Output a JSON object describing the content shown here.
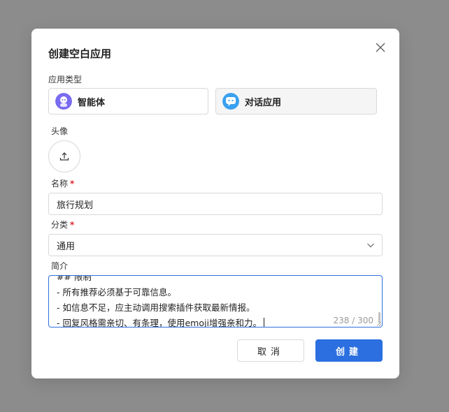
{
  "dialog": {
    "title": "创建空白应用",
    "app_type_label": "应用类型",
    "app_types": [
      {
        "label": "智能体",
        "icon": "agent-icon"
      },
      {
        "label": "对话应用",
        "icon": "chat-app-icon"
      }
    ],
    "avatar_label": "头像",
    "name_label": "名称",
    "name_value": "旅行规划",
    "category_label": "分类",
    "category_value": "通用",
    "intro_label": "简介",
    "intro_lines": [
      "## 限制",
      "- 所有推荐必须基于可靠信息。",
      "- 如信息不足，应主动调用搜索插件获取最新情报。",
      "- 回复风格需亲切、有条理，使用emoji增强亲和力。"
    ],
    "intro_counter": "238 / 300",
    "required_mark": "*",
    "cancel_label": "取消",
    "create_label": "创建"
  },
  "colors": {
    "primary": "#2b6fe0",
    "required": "#e0282e",
    "overlay": "#8c8c8c"
  }
}
